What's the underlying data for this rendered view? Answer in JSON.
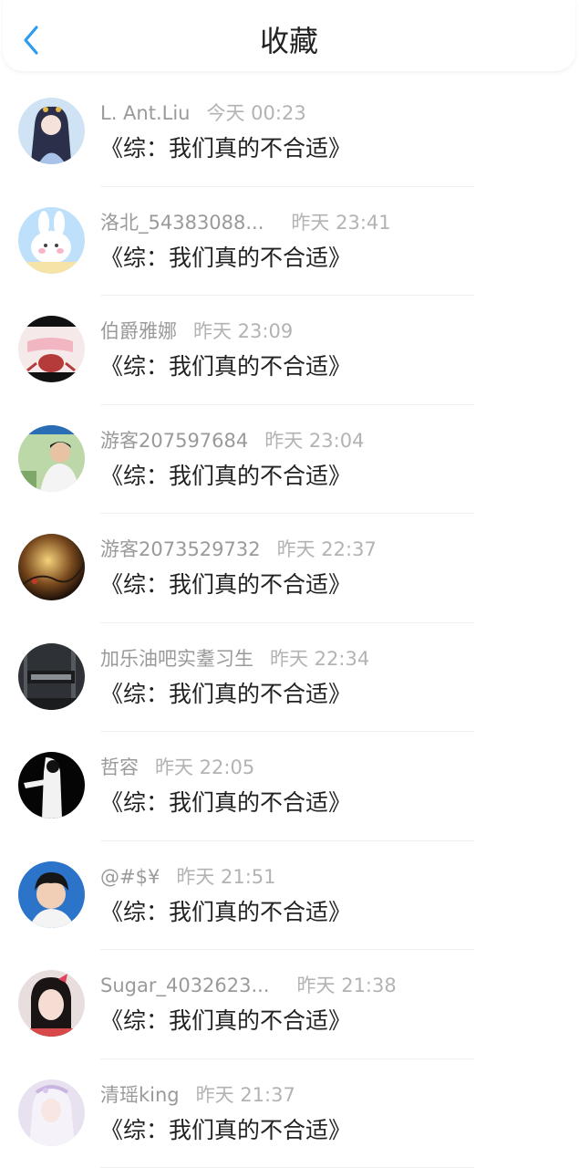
{
  "header": {
    "title": "收藏",
    "back_icon": "chevron-left-icon",
    "accent_color": "#2d9cf0"
  },
  "items": [
    {
      "user": "L. Ant.Liu",
      "time": "今天 00:23",
      "book": "《综：我们真的不合适》"
    },
    {
      "user": "洛北_54383088...",
      "time": "昨天 23:41",
      "book": "《综：我们真的不合适》"
    },
    {
      "user": "伯爵雅娜",
      "time": "昨天 23:09",
      "book": "《综：我们真的不合适》"
    },
    {
      "user": "游客207597684",
      "time": "昨天 23:04",
      "book": "《综：我们真的不合适》"
    },
    {
      "user": "游客2073529732",
      "time": "昨天 22:37",
      "book": "《综：我们真的不合适》"
    },
    {
      "user": "加乐油吧实耋习生",
      "time": "昨天 22:34",
      "book": "《综：我们真的不合适》"
    },
    {
      "user": "哲容",
      "time": "昨天 22:05",
      "book": "《综：我们真的不合适》"
    },
    {
      "user": "@#$¥",
      "time": "昨天 21:51",
      "book": "《综：我们真的不合适》"
    },
    {
      "user": "Sugar_4032623...",
      "time": "昨天 21:38",
      "book": "《综：我们真的不合适》"
    },
    {
      "user": "清瑶king",
      "time": "昨天 21:37",
      "book": "《综：我们真的不合适》"
    }
  ]
}
